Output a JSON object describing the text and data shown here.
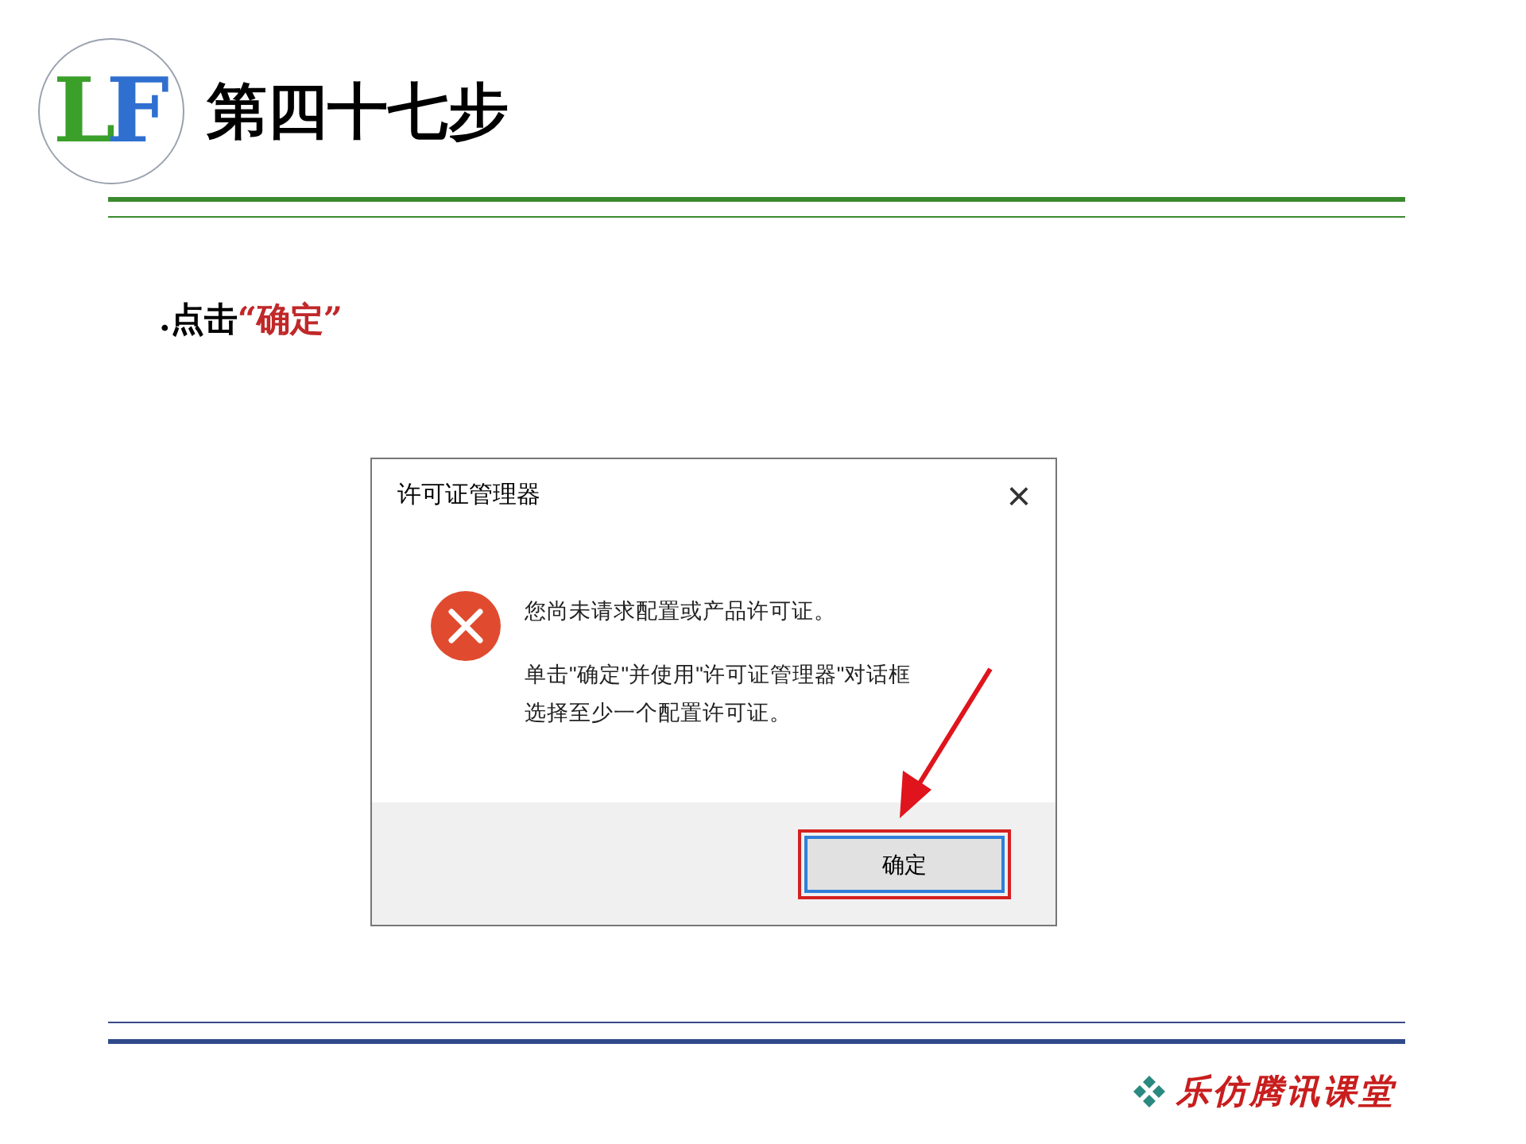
{
  "header": {
    "logo_letters": "LF",
    "title": "第四十七步"
  },
  "instruction": {
    "prefix": ".点击",
    "highlight": "“确定”"
  },
  "dialog": {
    "title": "许可证管理器",
    "close": "×",
    "message": "您尚未请求配置或产品许可证。",
    "detail_lines": [
      "单击\"确定\"并使用\"许可证管理器\"对话框",
      "选择至少一个配置许可证。"
    ],
    "buttons": [
      {
        "label": "确定",
        "highlighted": true
      }
    ]
  },
  "footer": {
    "brand": "乐仿腾讯课堂"
  }
}
